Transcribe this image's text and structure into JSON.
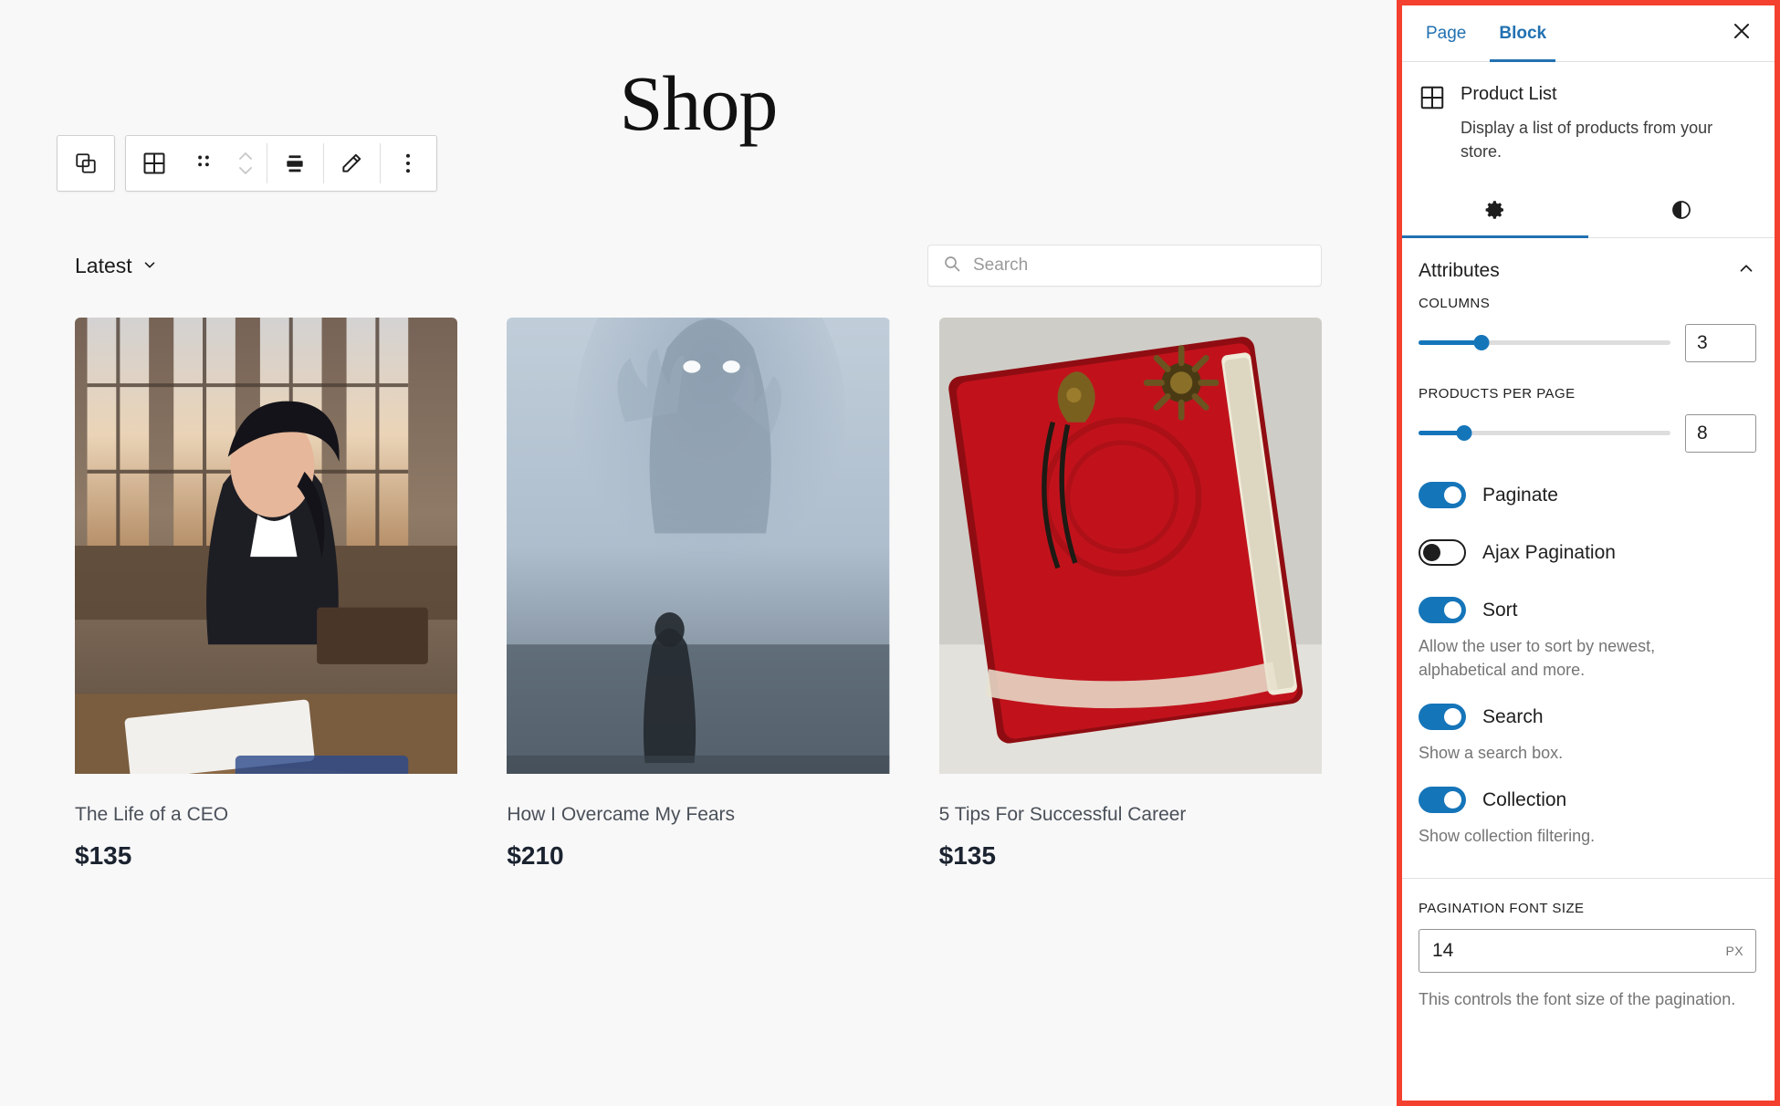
{
  "canvas": {
    "page_heading": "Shop",
    "toolbar": {
      "duplicate_label": "duplicate-block",
      "block_type_label": "Product List block",
      "drag_label": "drag",
      "move_up_label": "move up",
      "move_down_label": "move down",
      "align_label": "align",
      "edit_label": "edit",
      "more_label": "options"
    },
    "sort_dropdown": {
      "value": "Latest"
    },
    "search": {
      "placeholder": "Search",
      "value": ""
    },
    "products": [
      {
        "title": "The Life of a CEO",
        "price": "$135",
        "image": "ceo-woman-at-desk"
      },
      {
        "title": "How I Overcame My Fears",
        "price": "$210",
        "image": "foggy-ghost-figure"
      },
      {
        "title": "5 Tips For Successful Career",
        "price": "$135",
        "image": "red-leather-journal"
      }
    ]
  },
  "sidebar": {
    "tabs": [
      {
        "label": "Page",
        "active": false
      },
      {
        "label": "Block",
        "active": true
      }
    ],
    "close_label": "✕",
    "block": {
      "title": "Product List",
      "description": "Display a list of products from your store."
    },
    "icon_tabs": [
      {
        "name": "settings",
        "active": true
      },
      {
        "name": "styles",
        "active": false
      }
    ],
    "panel": {
      "title": "Attributes",
      "expanded": true,
      "columns": {
        "label": "COLUMNS",
        "value": "3",
        "slider_percent": 25
      },
      "products_per_page": {
        "label": "PRODUCTS PER PAGE",
        "value": "8",
        "slider_percent": 18
      },
      "toggles": [
        {
          "label": "Paginate",
          "on": true,
          "help": ""
        },
        {
          "label": "Ajax Pagination",
          "on": false,
          "help": ""
        },
        {
          "label": "Sort",
          "on": true,
          "help": "Allow the user to sort by newest, alphabetical and more."
        },
        {
          "label": "Search",
          "on": true,
          "help": "Show a search box."
        },
        {
          "label": "Collection",
          "on": true,
          "help": "Show collection filtering."
        }
      ],
      "pagination_font_size": {
        "label": "PAGINATION FONT SIZE",
        "value": "14",
        "unit": "PX",
        "help": "This controls the font size of the pagination."
      }
    }
  },
  "colors": {
    "accent_blue": "#2271b1",
    "slider_blue": "#1575b9",
    "highlight_border": "#f4402e",
    "canvas_bg": "#f8f8f8"
  }
}
